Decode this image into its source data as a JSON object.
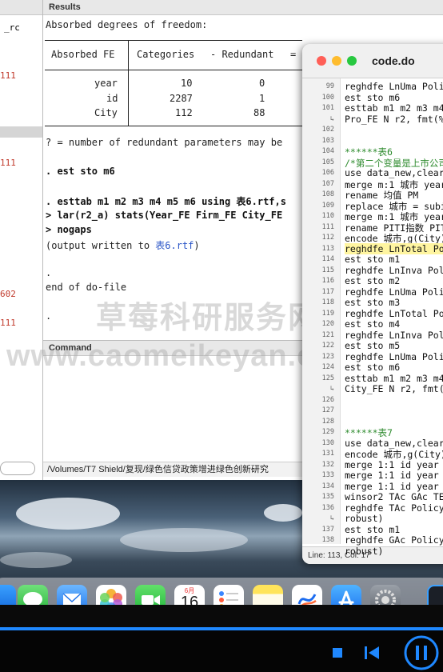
{
  "left_panel": {
    "header_text": "_rc",
    "values": [
      "111",
      "111",
      "602",
      "111"
    ]
  },
  "results": {
    "title": "Results",
    "lines": {
      "absorbed": "Absorbed degrees of freedom:",
      "col_fe": "Absorbed FE",
      "col_cat": "Categories",
      "col_red": "- Redundant",
      "col_eq": "=",
      "rows": [
        {
          "name": "year",
          "categories": "10",
          "redundant": "0"
        },
        {
          "name": "id",
          "categories": "2287",
          "redundant": "1"
        },
        {
          "name": "City",
          "categories": "112",
          "redundant": "88"
        }
      ],
      "note": "? = number of redundant parameters may be",
      "cmd1": ". est sto m6",
      "cmd2": ". esttab m1 m2 m3 m4 m5 m6 using 表6.rtf,s",
      "cmd3": "> lar(r2_a) stats(Year_FE Firm_FE City_FE",
      "cmd4": "> nogaps",
      "output_prefix": "(output written to ",
      "output_link": "表6.rtf",
      "output_suffix": ")",
      "dot1": ".",
      "end": "end of do-file",
      "dot2": "."
    }
  },
  "command": {
    "title": "Command",
    "path": "/Volumes/T7 Shield/复现/绿色信贷政策增进绿色创新研究"
  },
  "editor": {
    "title": "code.do",
    "status": "Line: 113, Col: 17",
    "lines": [
      {
        "n": "99",
        "text": "reghdfe LnUma Poli",
        "style": ""
      },
      {
        "n": "100",
        "text": "est sto m6",
        "style": ""
      },
      {
        "n": "101",
        "text": "esttab m1 m2 m3 m4",
        "style": ""
      },
      {
        "n": "↳",
        "text": "Pro_FE N r2, fmt(%",
        "style": ""
      },
      {
        "n": "102",
        "text": "",
        "style": ""
      },
      {
        "n": "103",
        "text": "",
        "style": ""
      },
      {
        "n": "104",
        "text": "******表6",
        "style": "comment"
      },
      {
        "n": "105",
        "text": "/*第二个变量是上市公司",
        "style": "comment"
      },
      {
        "n": "106",
        "text": "use data_new,clear",
        "style": ""
      },
      {
        "n": "107",
        "text": "merge m:1 城市 year",
        "style": ""
      },
      {
        "n": "108",
        "text": "rename 均值 PM",
        "style": ""
      },
      {
        "n": "109",
        "text": "replace 城市 = subi",
        "style": ""
      },
      {
        "n": "110",
        "text": "merge m:1 城市 year",
        "style": ""
      },
      {
        "n": "111",
        "text": "rename PITI指数 PIT",
        "style": ""
      },
      {
        "n": "112",
        "text": "encode 城市,g(City)",
        "style": ""
      },
      {
        "n": "113",
        "text": "reghdfe LnTotal Po",
        "style": "hl"
      },
      {
        "n": "114",
        "text": "est sto m1",
        "style": ""
      },
      {
        "n": "115",
        "text": "reghdfe LnInva Pol",
        "style": ""
      },
      {
        "n": "116",
        "text": "est sto m2",
        "style": ""
      },
      {
        "n": "117",
        "text": "reghdfe LnUma Poli",
        "style": ""
      },
      {
        "n": "118",
        "text": "est sto m3",
        "style": ""
      },
      {
        "n": "119",
        "text": "reghdfe LnTotal Po",
        "style": ""
      },
      {
        "n": "120",
        "text": "est sto m4",
        "style": ""
      },
      {
        "n": "121",
        "text": "reghdfe LnInva Pol",
        "style": ""
      },
      {
        "n": "122",
        "text": "est sto m5",
        "style": ""
      },
      {
        "n": "123",
        "text": "reghdfe LnUma Poli",
        "style": ""
      },
      {
        "n": "124",
        "text": "est sto m6",
        "style": ""
      },
      {
        "n": "125",
        "text": "esttab m1 m2 m3 m4",
        "style": ""
      },
      {
        "n": "↳",
        "text": "City_FE N r2, fmt(",
        "style": ""
      },
      {
        "n": "126",
        "text": "",
        "style": ""
      },
      {
        "n": "127",
        "text": "",
        "style": ""
      },
      {
        "n": "128",
        "text": "",
        "style": ""
      },
      {
        "n": "129",
        "text": "******表7",
        "style": "comment"
      },
      {
        "n": "130",
        "text": "use data_new,clear",
        "style": ""
      },
      {
        "n": "131",
        "text": "encode 城市,g(City)",
        "style": ""
      },
      {
        "n": "132",
        "text": "merge 1:1 id year",
        "style": ""
      },
      {
        "n": "133",
        "text": "merge 1:1 id year",
        "style": ""
      },
      {
        "n": "134",
        "text": "merge 1:1 id year",
        "style": ""
      },
      {
        "n": "135",
        "text": "winsor2 TAc GAc TE",
        "style": ""
      },
      {
        "n": "136",
        "text": "reghdfe TAc Policy",
        "style": ""
      },
      {
        "n": "↳",
        "text": "robust)",
        "style": ""
      },
      {
        "n": "137",
        "text": "est sto m1",
        "style": ""
      },
      {
        "n": "138",
        "text": "reghdfe GAc Policy",
        "style": ""
      },
      {
        "n": "↳",
        "text": "robust)",
        "style": ""
      }
    ]
  },
  "dock": {
    "calendar_month": "6月",
    "calendar_day": "16",
    "apps": [
      "messages-icon",
      "mail-icon",
      "photos-icon",
      "facetime-icon",
      "calendar-icon",
      "reminders-icon",
      "notes-icon",
      "freeform-icon",
      "app-store-icon",
      "system-settings-icon"
    ]
  },
  "watermark": {
    "line1": "草莓科研服务网",
    "line2": "www.caomeikeyan.com"
  },
  "colors": {
    "link": "#2a55c7",
    "comment": "#2e8b2e",
    "progress": "#1f88ff"
  }
}
